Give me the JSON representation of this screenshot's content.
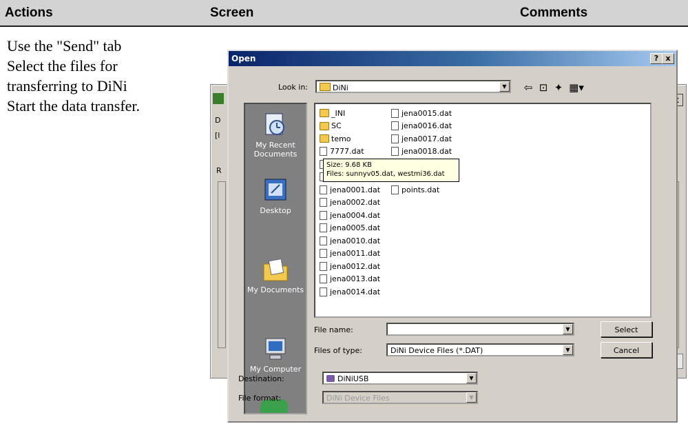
{
  "header": {
    "actions": "Actions",
    "screen": "Screen",
    "comments": "Comments"
  },
  "actions_text": [
    "Use the \"Send\" tab",
    "Select the files for",
    "transferring to DiNi",
    "Start the data transfer."
  ],
  "background_window": {
    "frag_d": "D",
    "frag_b": "[l",
    "frag_r": "R",
    "close": "x"
  },
  "dialog": {
    "title": "Open",
    "help_button": "?",
    "close_button": "x",
    "look_in_label": "Look in:",
    "look_in_value": "DiNi",
    "places": [
      "My Recent Documents",
      "Desktop",
      "My Documents",
      "My Computer"
    ],
    "files_col1": [
      {
        "name": "_INI",
        "type": "folder"
      },
      {
        "name": "SC",
        "type": "folder"
      },
      {
        "name": "temo",
        "type": "folder"
      },
      {
        "name": "7777.dat",
        "type": "file"
      },
      {
        "name": "",
        "type": "file"
      },
      {
        "name": "",
        "type": "file"
      },
      {
        "name": "jena0001.dat",
        "type": "file"
      },
      {
        "name": "jena0002.dat",
        "type": "file"
      },
      {
        "name": "jena0004.dat",
        "type": "file"
      },
      {
        "name": "jena0005.dat",
        "type": "file"
      },
      {
        "name": "jena0010.dat",
        "type": "file"
      },
      {
        "name": "jena0011.dat",
        "type": "file"
      },
      {
        "name": "jena0012.dat",
        "type": "file"
      },
      {
        "name": "jena0013.dat",
        "type": "file"
      },
      {
        "name": "jena0014.dat",
        "type": "file"
      }
    ],
    "files_col2": [
      {
        "name": "jena0015.dat",
        "type": "file"
      },
      {
        "name": "jena0016.dat",
        "type": "file"
      },
      {
        "name": "jena0017.dat",
        "type": "file"
      },
      {
        "name": "jena0018.dat",
        "type": "file"
      },
      {
        "name": "",
        "type": "none"
      },
      {
        "name": "",
        "type": "none"
      },
      {
        "name": "points.dat",
        "type": "file"
      }
    ],
    "tooltip": {
      "size": "Size: 9.68 KB",
      "files": "Files: sunnyv05.dat, westmi36.dat"
    },
    "file_name_label": "File name:",
    "file_name_value": "",
    "files_of_type_label": "Files of type:",
    "files_of_type_value": "DiNi Device Files (*.DAT)",
    "select_button": "Select",
    "cancel_button": "Cancel",
    "destination_label": "Destination:",
    "destination_value": "DiNiUSB",
    "file_format_label": "File format:",
    "file_format_value": "DiNi Device Files"
  },
  "colors": {
    "title_start": "#0a246a",
    "title_end": "#a6caf0",
    "dialog_bg": "#d4d0c8",
    "places_bg": "#808080",
    "tooltip_bg": "#ffffe1"
  }
}
